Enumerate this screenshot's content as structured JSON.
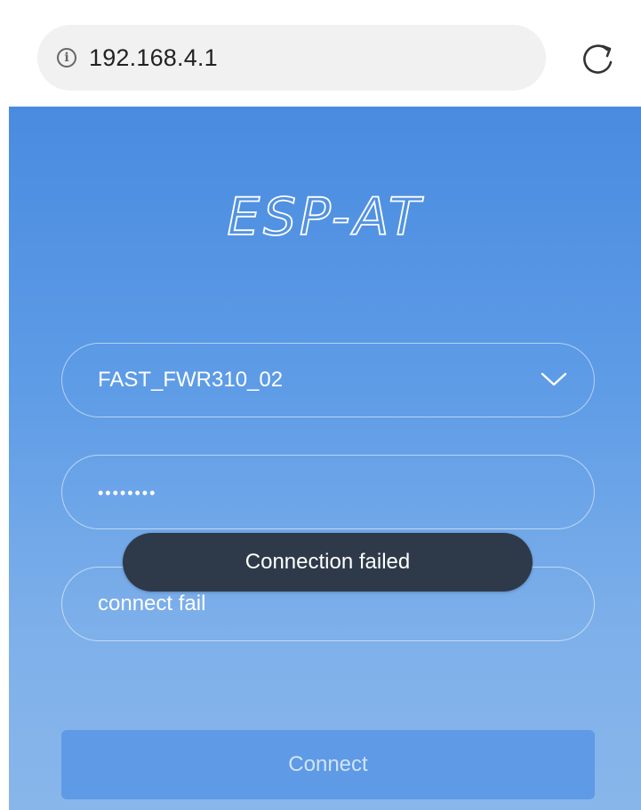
{
  "browser": {
    "url": "192.168.4.1",
    "info_icon": "info-icon",
    "reload_icon": "reload-icon"
  },
  "page": {
    "logo_text": "ESP-AT",
    "ssid": {
      "value": "FAST_FWR310_02",
      "icon": "chevron-down-icon"
    },
    "password": {
      "masked_value": "••••••••"
    },
    "status": {
      "value": "connect fail"
    },
    "connect_label": "Connect",
    "toast": "Connection failed"
  },
  "colors": {
    "gradient_top": "#4a8be0",
    "gradient_bottom": "#88b6ea",
    "toast_bg": "#2e3a4a",
    "button_bg": "#5e9ae6"
  }
}
